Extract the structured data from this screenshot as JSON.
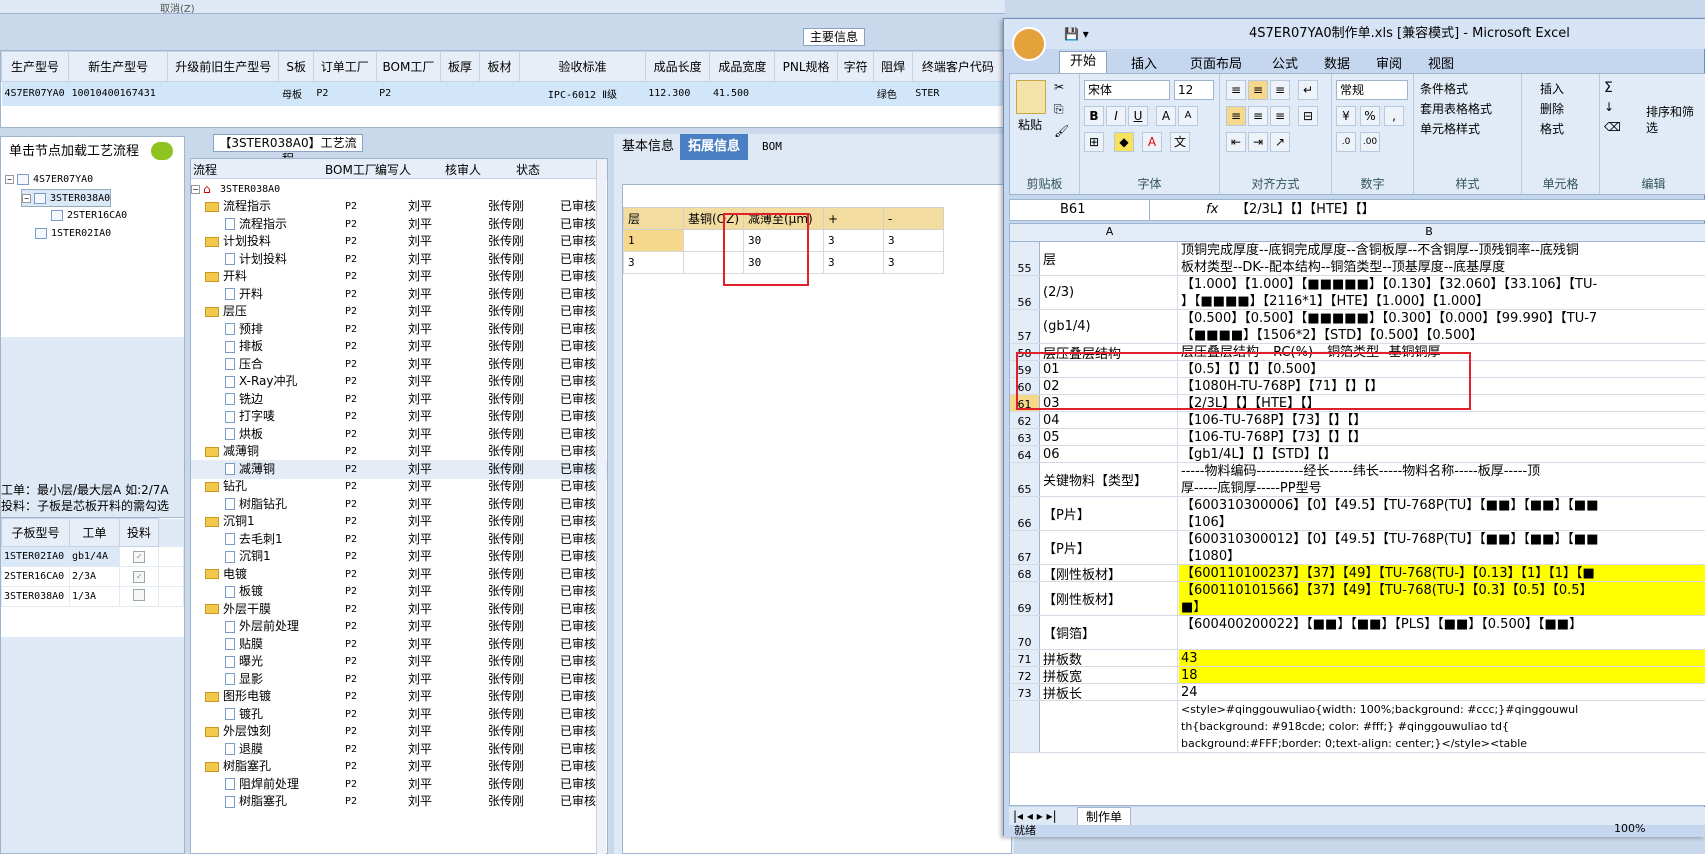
{
  "top": {
    "cancel_label": "取消(Z)",
    "main_info_title": "主要信息"
  },
  "main_grid": {
    "headers": [
      "生产型号",
      "新生产型号",
      "升级前旧生产型号",
      "S板",
      "订单工厂",
      "BOM工厂",
      "板厚",
      "板材",
      "验收标准",
      "成品长度",
      "成品宽度",
      "PNL规格",
      "字符",
      "阻焊",
      "终端客户代码"
    ],
    "row": [
      "4S7ER07YA0",
      "10010400167431",
      "",
      "母板",
      "P2",
      "P2",
      "",
      "",
      "IPC-6012 Ⅱ级",
      "112.300",
      "41.500",
      "",
      "",
      "绿色",
      "STER"
    ]
  },
  "left": {
    "header": "单击节点加载工艺流程",
    "tree": [
      "4S7ER07YA0",
      "3STER038A0",
      "2STER16CA0",
      "1STER02IA0"
    ],
    "note_line1": "工单：最小层/最大层A 如:2/7A",
    "note_line2": "投料：子板是芯板开料的需勾选",
    "sub_headers": [
      "子板型号",
      "工单",
      "投料"
    ],
    "sub_rows": [
      [
        "1STER02IA0",
        "gb1/4A"
      ],
      [
        "2STER16CA0",
        "2/3A"
      ],
      [
        "3STER038A0",
        "1/3A"
      ]
    ]
  },
  "process": {
    "title": "【3STER038A0】工艺流程",
    "headers": [
      "流程",
      "BOM工厂",
      "编写人",
      "核审人",
      "状态"
    ],
    "root": "3STER038A0",
    "factory": "P2",
    "writer": "刘平",
    "reviewer": "张传刚",
    "status": "已审核",
    "rows": [
      {
        "t": "f",
        "n": "流程指示"
      },
      {
        "t": "d",
        "n": "流程指示"
      },
      {
        "t": "f",
        "n": "计划投料"
      },
      {
        "t": "d",
        "n": "计划投料"
      },
      {
        "t": "f",
        "n": "开料"
      },
      {
        "t": "d",
        "n": "开料"
      },
      {
        "t": "f",
        "n": "层压"
      },
      {
        "t": "d",
        "n": "预排"
      },
      {
        "t": "d",
        "n": "排板"
      },
      {
        "t": "d",
        "n": "压合"
      },
      {
        "t": "d",
        "n": "X-Ray冲孔"
      },
      {
        "t": "d",
        "n": "铣边"
      },
      {
        "t": "d",
        "n": "打字唛"
      },
      {
        "t": "d",
        "n": "烘板"
      },
      {
        "t": "f",
        "n": "减薄铜"
      },
      {
        "t": "d",
        "n": "减薄铜"
      },
      {
        "t": "f",
        "n": "钻孔"
      },
      {
        "t": "d",
        "n": "树脂钻孔"
      },
      {
        "t": "f",
        "n": "沉铜1"
      },
      {
        "t": "d",
        "n": "去毛刺1"
      },
      {
        "t": "d",
        "n": "沉铜1"
      },
      {
        "t": "f",
        "n": "电镀"
      },
      {
        "t": "d",
        "n": "板镀"
      },
      {
        "t": "f",
        "n": "外层干膜"
      },
      {
        "t": "d",
        "n": "外层前处理"
      },
      {
        "t": "d",
        "n": "贴膜"
      },
      {
        "t": "d",
        "n": "曝光"
      },
      {
        "t": "d",
        "n": "显影"
      },
      {
        "t": "f",
        "n": "图形电镀"
      },
      {
        "t": "d",
        "n": "镀孔"
      },
      {
        "t": "f",
        "n": "外层蚀刻"
      },
      {
        "t": "d",
        "n": "退膜"
      },
      {
        "t": "f",
        "n": "树脂塞孔"
      },
      {
        "t": "d",
        "n": "阻焊前处理"
      },
      {
        "t": "d",
        "n": "树脂塞孔"
      }
    ]
  },
  "mid": {
    "tabs": [
      "基本信息",
      "拓展信息",
      "BOM"
    ],
    "layer_headers": [
      "层",
      "基铜(OZ)",
      "减薄至(μm)",
      "+",
      "-"
    ],
    "layer_rows": [
      [
        "1",
        "",
        "30",
        "3",
        "3"
      ],
      [
        "3",
        "",
        "30",
        "3",
        "3"
      ]
    ]
  },
  "excel": {
    "title": "4S7ER07YA0制作单.xls [兼容模式] - Microsoft Excel",
    "tabs": [
      "开始",
      "插入",
      "页面布局",
      "公式",
      "数据",
      "审阅",
      "视图"
    ],
    "font": "宋体",
    "size": "12",
    "numfmt": "常规",
    "groups": [
      "剪贴板",
      "字体",
      "对齐方式",
      "数字",
      "样式",
      "单元格",
      "编辑"
    ],
    "paste": "粘贴",
    "style_btns": [
      "条件格式",
      "套用表格格式",
      "单元格样式"
    ],
    "cell_btns": [
      "插入",
      "删除",
      "格式"
    ],
    "edit_btn": "排序和筛选",
    "cell_ref": "B61",
    "formula": "【2/3L】【】【HTE】【】",
    "col_a": "A",
    "col_b": "B",
    "rows": [
      {
        "n": "55",
        "a": "层",
        "b": "顶铜完成厚度--底铜完成厚度--含铜板厚--不含铜厚--顶残铜率--底残铜\n板材类型--DK--配本结构--铜箔类型--顶基厚度--底基厚度",
        "h": 34
      },
      {
        "n": "56",
        "a": "(2/3)",
        "b": "【1.000】【1.000】【■■■■■】【0.130】【32.060】【33.106】【TU-\n】【■■■■】【2116*1】【HTE】【1.000】【1.000】",
        "h": 34
      },
      {
        "n": "57",
        "a": "(gb1/4)",
        "b": "【0.500】【0.500】【■■■■■】【0.300】【0.000】【99.990】【TU-7\n【■■■■】【1506*2】【STD】【0.500】【0.500】",
        "h": 34
      },
      {
        "n": "58",
        "a": "层压叠层结构",
        "b": "层压叠层结构---RC(%)---铜箔类型--基铜铜厚",
        "h": 17
      },
      {
        "n": "59",
        "a": "01",
        "b": "【0.5】【】【】【0.500】",
        "h": 17
      },
      {
        "n": "60",
        "a": "02",
        "b": "【1080H-TU-768P】【71】【】【】",
        "h": 17
      },
      {
        "n": "61",
        "a": "03",
        "b": "【2/3L】【】【HTE】【】",
        "h": 17
      },
      {
        "n": "62",
        "a": "04",
        "b": "【106-TU-768P】【73】【】【】",
        "h": 17
      },
      {
        "n": "63",
        "a": "05",
        "b": "【106-TU-768P】【73】【】【】",
        "h": 17
      },
      {
        "n": "64",
        "a": "06",
        "b": "【gb1/4L】【】【STD】【】",
        "h": 17
      },
      {
        "n": "65",
        "a": "关键物料【类型】",
        "b": "-----物料编码----------经长-----纬长-----物料名称-----板厚-----顶\n厚-----底铜厚-----PP型号",
        "h": 34
      },
      {
        "n": "66",
        "a": "【P片】",
        "b": "【600310300006】【0】【49.5】【TU-768P(TU】【■■】【■■】【■■\n【106】",
        "h": 34
      },
      {
        "n": "67",
        "a": "【P片】",
        "b": "【600310300012】【0】【49.5】【TU-768P(TU】【■■】【■■】【■■\n【1080】",
        "h": 34
      },
      {
        "n": "68",
        "a": "【刚性板材】",
        "b": "【600110100237】【37】【49】【TU-768(TU-】【0.13】【1】【1】【■",
        "h": 17,
        "y": true
      },
      {
        "n": "69",
        "a": "【刚性板材】",
        "b": "【600110101566】【37】【49】【TU-768(TU-】【0.3】【0.5】【0.5】\n■】",
        "h": 34,
        "y": true
      },
      {
        "n": "70",
        "a": "【铜箔】",
        "b": "【600400200022】【■■】【■■】【PLS】【■■】【0.500】【■■】",
        "h": 34
      },
      {
        "n": "71",
        "a": "拼板数",
        "b": "43",
        "h": 17,
        "y": true
      },
      {
        "n": "72",
        "a": "拼板宽",
        "b": "18",
        "h": 17,
        "y": true
      },
      {
        "n": "73",
        "a": "拼板长",
        "b": "24",
        "h": 17
      },
      {
        "n": "",
        "a": "",
        "b": "<style>#qinggouwuliao{width: 100%;background: #ccc;}#qinggouwul\nth{background: #918cde; color: #fff;} #qinggouwuliao td{\nbackground:#FFF;border: 0;text-align: center;}</style><table",
        "h": 52
      }
    ],
    "sheet_tab": "制作单",
    "status": "就绪",
    "zoom": "100%"
  }
}
